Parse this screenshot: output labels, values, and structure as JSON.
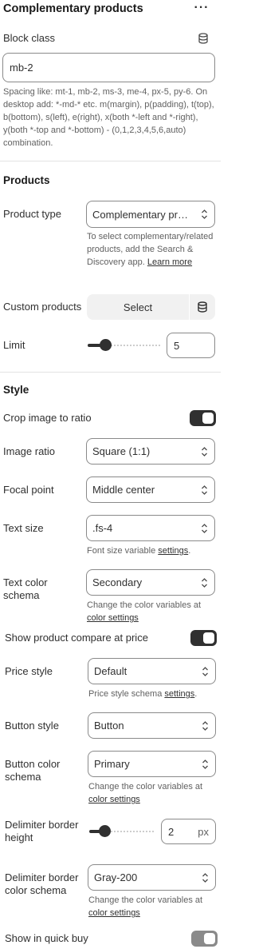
{
  "header": {
    "title": "Complementary products",
    "more_icon": "more-horizontal-icon"
  },
  "block_class": {
    "label": "Block class",
    "value": "mb-2",
    "help": "Spacing like: mt-1, mb-2, ms-3, me-4, px-5, py-6. On desktop add: *-md-* etc. m(margin), p(padding), t(top), b(bottom), s(left), e(right), x(both *-left and *-right), y(both *-top and *-bottom) - (0,1,2,3,4,5,6,auto) combination."
  },
  "products": {
    "title": "Products",
    "product_type": {
      "label": "Product type",
      "value": "Complementary products",
      "help_prefix": "To select complementary/related products, add the Search & Discovery app.",
      "help_link": "Learn more"
    },
    "custom_products": {
      "label": "Custom products",
      "button": "Select"
    },
    "limit": {
      "label": "Limit",
      "value": "5",
      "fraction": 0.1
    }
  },
  "style": {
    "title": "Style",
    "crop_image": {
      "label": "Crop image to ratio",
      "checked": true
    },
    "image_ratio": {
      "label": "Image ratio",
      "value": "Square (1:1)"
    },
    "focal_point": {
      "label": "Focal point",
      "value": "Middle center"
    },
    "text_size": {
      "label": "Text size",
      "value": ".fs-4",
      "help_prefix": "Font size variable",
      "help_link": "settings",
      "help_suffix": "."
    },
    "text_color_schema": {
      "label_line1": "Text color",
      "label_line2": "schema",
      "value": "Secondary",
      "help_prefix": "Change the color variables at",
      "help_link": "color settings"
    },
    "show_compare_price": {
      "label": "Show product compare at price",
      "checked": true
    },
    "price_style": {
      "label": "Price style",
      "value": "Default",
      "help_prefix": "Price style schema",
      "help_link": "settings",
      "help_suffix": "."
    },
    "button_style": {
      "label": "Button style",
      "value": "Button"
    },
    "button_color_schema": {
      "label_line1": "Button color",
      "label_line2": "schema",
      "value": "Primary",
      "help_prefix": "Change the color variables at",
      "help_link": "color settings"
    },
    "delimiter_border_height": {
      "label_line1": "Delimiter border",
      "label_line2": "height",
      "value": "2",
      "unit": "px",
      "fraction": 0.15
    },
    "delimiter_border_color": {
      "label_line1": "Delimiter border",
      "label_line2": "color schema",
      "value": "Gray-200",
      "help_prefix": "Change the color variables at",
      "help_link": "color settings"
    },
    "show_quick_buy": {
      "label": "Show in quick buy",
      "checked": false
    }
  }
}
